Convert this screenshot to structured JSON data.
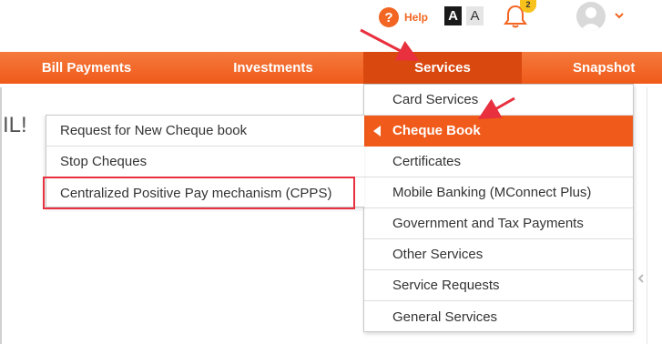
{
  "header": {
    "help_label": "Help",
    "font_large_label": "A",
    "font_small_label": "A",
    "notification_count": "2",
    "accent_color": "#f26522"
  },
  "nav": {
    "items": [
      {
        "label": "Bill Payments"
      },
      {
        "label": "Investments"
      },
      {
        "label": "Services"
      },
      {
        "label": "Snapshot"
      }
    ],
    "active_item": "Services"
  },
  "page": {
    "greeting": "IL!"
  },
  "services_menu": {
    "items": [
      {
        "label": "Card Services"
      },
      {
        "label": "Cheque Book"
      },
      {
        "label": "Certificates"
      },
      {
        "label": "Mobile Banking (MConnect Plus)"
      },
      {
        "label": "Government and Tax Payments"
      },
      {
        "label": "Other Services"
      },
      {
        "label": "Service Requests"
      },
      {
        "label": "General Services"
      }
    ],
    "active_item": "Cheque Book"
  },
  "cheque_submenu": {
    "items": [
      {
        "label": "Request for New Cheque book"
      },
      {
        "label": "Stop Cheques"
      },
      {
        "label": "Centralized Positive Pay mechanism (CPPS)"
      }
    ],
    "highlighted_item": "Centralized Positive Pay mechanism (CPPS)"
  },
  "annotation_color": "#e8303e"
}
